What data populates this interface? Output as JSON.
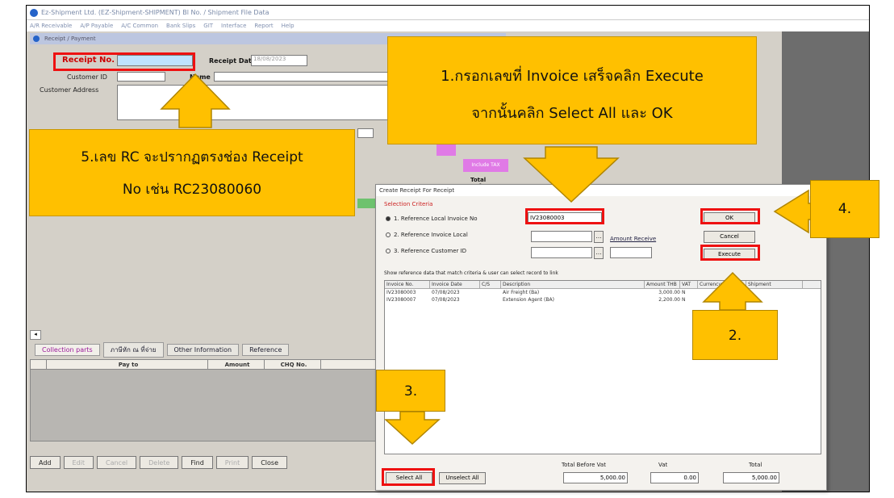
{
  "window": {
    "title": "Ez-Shipment Ltd. (EZ-Shipment-SHIPMENT) Bl No. / Shipment File Data",
    "menu": [
      "A/R Receivable",
      "A/P Payable",
      "A/C Common",
      "Bank Slips",
      "GIT",
      "Interface",
      "Report",
      "Help"
    ]
  },
  "form": {
    "header": "Receipt / Payment",
    "receipt_no_label": "Receipt No.",
    "receipt_no_value": "",
    "receipt_date_label": "Receipt Date",
    "receipt_date_value": "18/08/2023",
    "customer_id_label": "Customer ID",
    "name_label": "Name",
    "customer_address_label": "Customer Address",
    "include_tax_label": "Include TAX",
    "total_reference_label": "Total Reference",
    "tabs": [
      "Collection parts",
      "ภาษีหัก ณ ที่จ่าย",
      "Other Information",
      "Reference"
    ],
    "grid_headers": [
      "Pay to",
      "Amount",
      "CHQ No."
    ],
    "buttons": [
      "Add",
      "Edit",
      "Cancel",
      "Delete",
      "Find",
      "Print",
      "Close"
    ]
  },
  "dialog": {
    "title": "Create Receipt For Receipt",
    "section": "Selection Criteria",
    "options": [
      "1. Reference Local Invoice No",
      "2. Reference Invoice Local",
      "3. Reference Customer ID"
    ],
    "ref_value": "IV23080003",
    "amount_receive_label": "Amount Receive",
    "ok": "OK",
    "cancel": "Cancel",
    "execute": "Execute",
    "hint": "Show reference data that match criteria & user can select record to link",
    "columns": [
      "Invoice No.",
      "Invoice Date",
      "C/S",
      "Description",
      "Amount THB",
      "VAT",
      "Currency",
      "Shipment"
    ],
    "rows": [
      {
        "inv": "IV23080003",
        "date": "07/08/2023",
        "cs": "",
        "desc": "Air Freight (Ba)",
        "amt": "3,000.00",
        "vat": "N"
      },
      {
        "inv": "IV23080007",
        "date": "07/08/2023",
        "cs": "",
        "desc": "Extension Agent (BA)",
        "amt": "2,200.00",
        "vat": "N"
      }
    ],
    "select_all": "Select All",
    "unselect_all": "Unselect All",
    "total_before_vat_label": "Total Before Vat",
    "vat_label": "Vat",
    "total_label": "Total",
    "total_before_vat": "5,000.00",
    "vat": "0.00",
    "total": "5,000.00"
  },
  "callouts": {
    "c1_line1": "1.กรอกเลขที่ Invoice เสร็จคลิก Execute",
    "c1_line2": "จากนั้นคลิก Select All และ OK",
    "c5_line1": "5.เลข RC จะปรากฏตรงช่อง Receipt",
    "c5_line2": "No เช่น RC23080060",
    "step2": "2.",
    "step3": "3.",
    "step4": "4."
  },
  "colors": {
    "callout": "#ffc000",
    "highlight": "#e11111"
  }
}
